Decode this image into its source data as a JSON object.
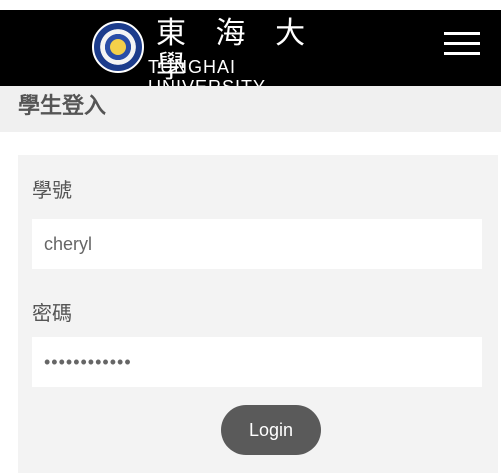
{
  "header": {
    "cn_title": "東 海 大 學",
    "en_title": "TUNGHAI UNIVERSITY",
    "menu_icon": "hamburger-menu-icon"
  },
  "page": {
    "title": "學生登入"
  },
  "form": {
    "student_id_label": "學號",
    "student_id_value": "cheryl",
    "password_label": "密碼",
    "password_value": "••••••••••••",
    "login_label": "Login"
  },
  "colors": {
    "header_bg": "#000000",
    "subbar_bg": "#f0f0f0",
    "card_bg": "#f3f3f3",
    "button_bg": "#5a5a5a"
  }
}
